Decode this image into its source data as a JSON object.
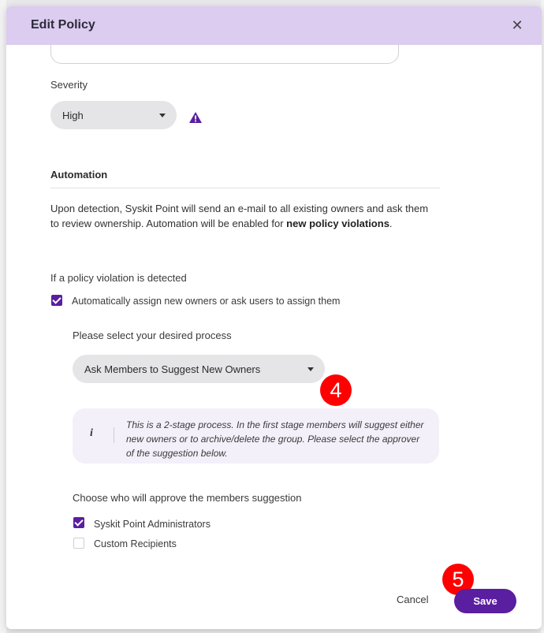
{
  "modal": {
    "title": "Edit Policy",
    "close_icon": "close-icon"
  },
  "severity": {
    "label": "Severity",
    "value": "High",
    "icon": "warning-icon",
    "icon_color": "#5a1ea0"
  },
  "automation": {
    "title": "Automation",
    "description_part1": "Upon detection, Syskit Point will send an e-mail to all existing owners and ask them to review ownership. Automation will be enabled for ",
    "description_bold": "new policy violations",
    "description_end": ".",
    "violation_label": "If a policy violation is detected",
    "auto_assign_label": "Automatically assign new owners or ask users to assign them",
    "auto_assign_checked": true,
    "process_label": "Please select your desired process",
    "process_value": "Ask Members to Suggest New Owners",
    "info_text": "This is a 2-stage process. In the first stage members will suggest either new owners or to archive/delete the group. Please select the approver of the suggestion below.",
    "approver_label": "Choose who will approve the members suggestion",
    "approvers": [
      {
        "label": "Syskit Point Administrators",
        "checked": true
      },
      {
        "label": "Custom Recipients",
        "checked": false
      }
    ]
  },
  "annotations": {
    "step4": "4",
    "step5": "5",
    "color": "#ff0000"
  },
  "footer": {
    "cancel_label": "Cancel",
    "save_label": "Save"
  },
  "colors": {
    "accent": "#5a1ea0",
    "header_bg": "#dcccf0"
  }
}
